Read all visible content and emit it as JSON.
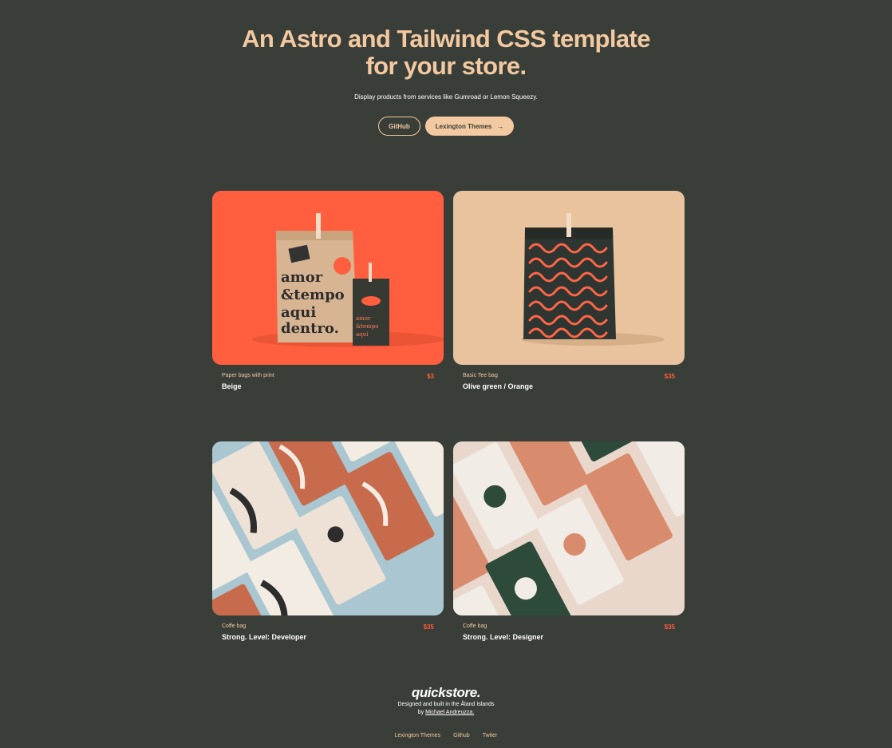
{
  "hero": {
    "title": "An Astro and Tailwind CSS template for your store.",
    "subtitle": "Display products from services like Gumroad or Lemon Squeezy.",
    "github_label": "GitHub",
    "lexington_label": "Lexington Themes",
    "arrow": "→"
  },
  "products": [
    {
      "category": "Paper bags with print",
      "name": "Beige",
      "price": "$3"
    },
    {
      "category": "Basic Tee bag",
      "name": "Olive green / Orange",
      "price": "$35"
    },
    {
      "category": "Coffe bag",
      "name": "Strong. Level: Developer",
      "price": "$35"
    },
    {
      "category": "Coffe bag",
      "name": "Strong. Level: Designer",
      "price": "$35"
    }
  ],
  "footer": {
    "logo": "quickstore.",
    "line1": "Designed and built in the Åland Islands",
    "by": "by",
    "author": "Michael Andreuzza.",
    "links": [
      "Lexington Themes",
      "Github",
      "Twiter"
    ]
  },
  "colors": {
    "background": "#3a3e38",
    "accent": "#f2c9a0",
    "price": "#ff5a3c"
  }
}
